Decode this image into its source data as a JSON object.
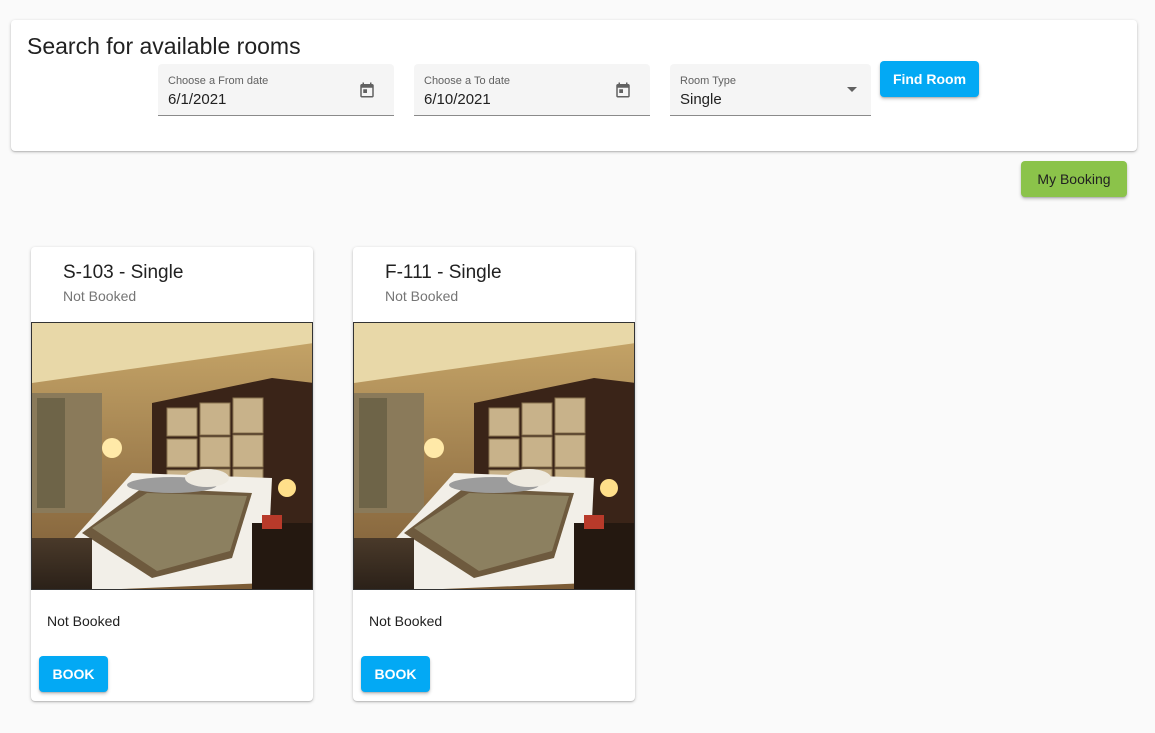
{
  "search": {
    "title": "Search for available rooms",
    "from_date": {
      "label": "Choose a From date",
      "value": "6/1/2021",
      "icon": "calendar-icon"
    },
    "to_date": {
      "label": "Choose a To date",
      "value": "6/10/2021",
      "icon": "calendar-icon"
    },
    "room_type": {
      "label": "Room Type",
      "value": "Single",
      "icon": "dropdown-arrow-icon"
    },
    "find_button": "Find Room"
  },
  "my_booking_button": "My Booking",
  "rooms": [
    {
      "title": "S-103 - Single",
      "subtitle": "Not Booked",
      "status": "Not Booked",
      "book_label": "BOOK",
      "image": "hotel-bedroom-photo"
    },
    {
      "title": "F-111 - Single",
      "subtitle": "Not Booked",
      "status": "Not Booked",
      "book_label": "BOOK",
      "image": "hotel-bedroom-photo"
    }
  ],
  "colors": {
    "primary": "#03a9f4",
    "accent_green": "#8bc34a",
    "background": "#fafafa",
    "field_bg": "#f5f5f5"
  }
}
